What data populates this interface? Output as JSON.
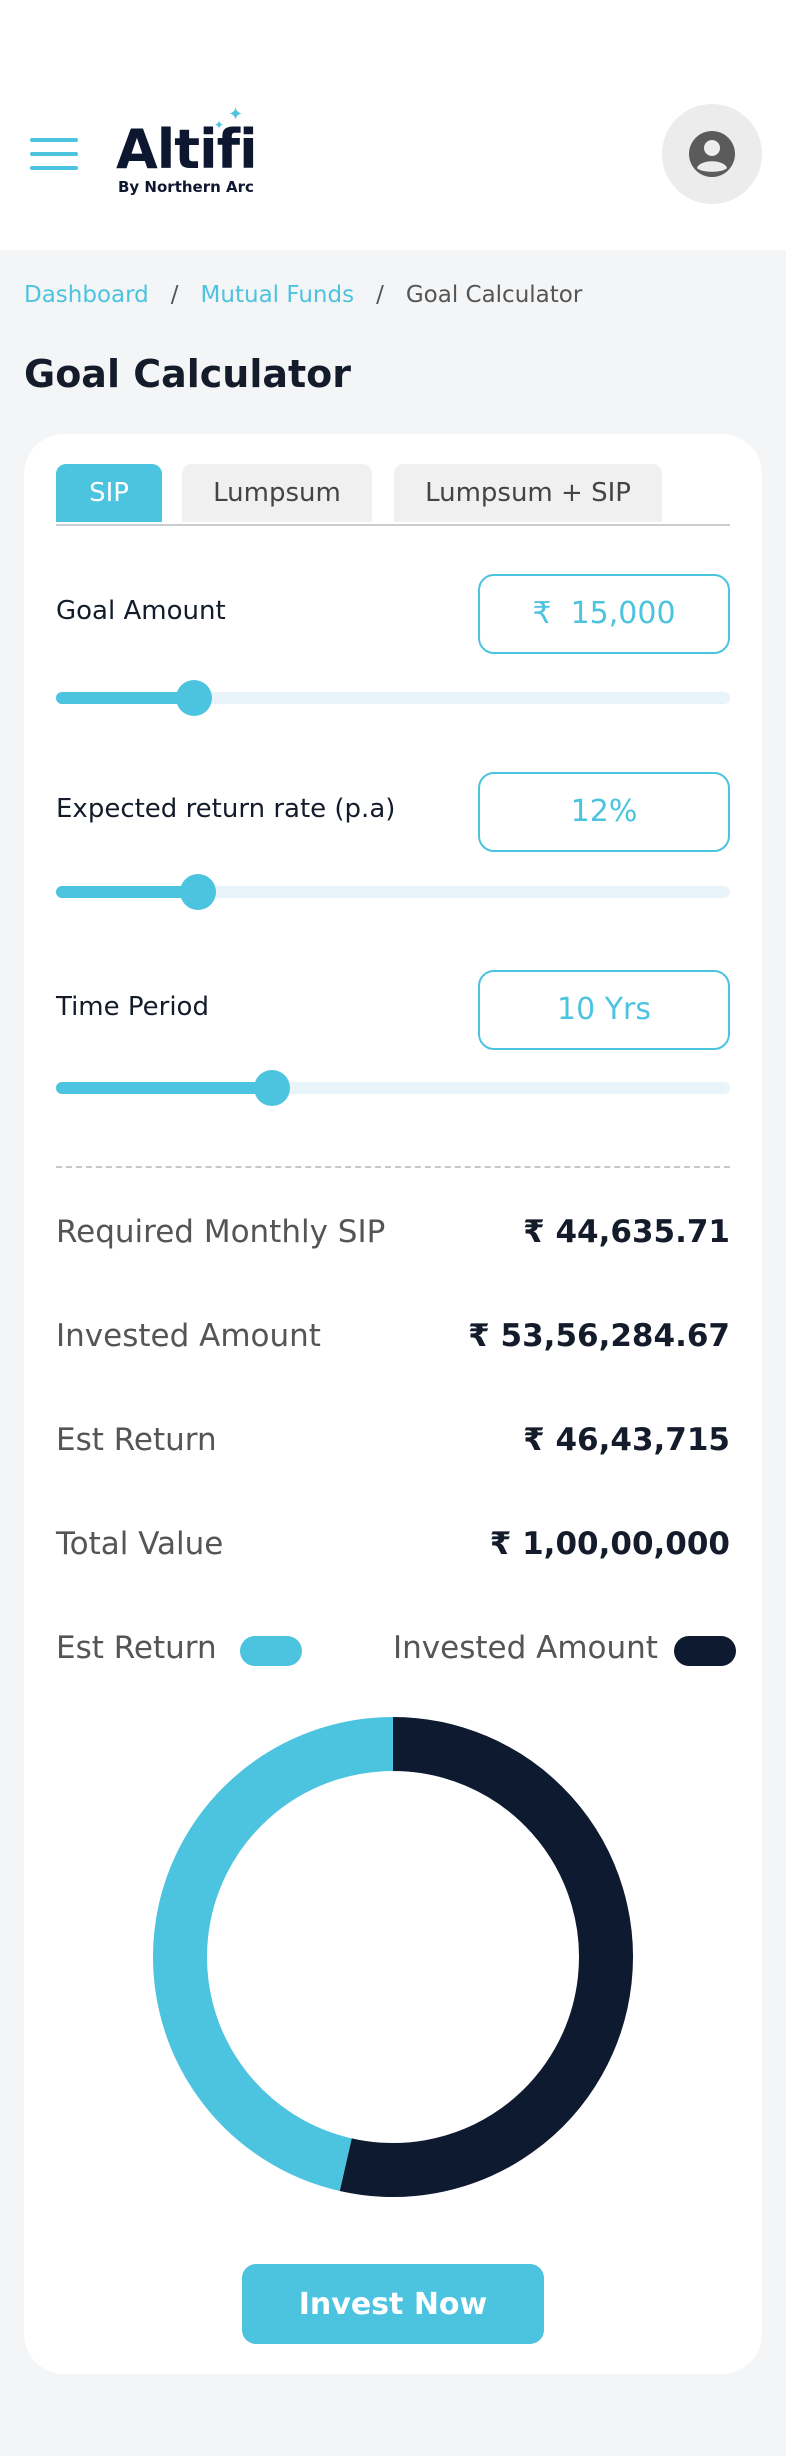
{
  "brand": {
    "logo_word": "Altifi",
    "logo_sub": "By Northern Arc",
    "accent": "#4cc3df",
    "dark": "#0e1a30"
  },
  "header": {
    "menu_icon": "hamburger-menu-icon",
    "avatar_icon": "user-avatar-icon"
  },
  "breadcrumb": {
    "items": [
      "Dashboard",
      "Mutual Funds",
      "Goal Calculator"
    ],
    "separator": "/"
  },
  "page_title": "Goal Calculator",
  "tabs": [
    {
      "label": "SIP",
      "active": true
    },
    {
      "label": "Lumpsum",
      "active": false
    },
    {
      "label": "Lumpsum + SIP",
      "active": false
    }
  ],
  "inputs": {
    "goal_amount": {
      "label": "Goal Amount",
      "value": "₹  15,000",
      "slider_percent": 20.5
    },
    "return_rate": {
      "label": "Expected return rate (p.a)",
      "value": "12%",
      "slider_percent": 21
    },
    "time_period": {
      "label": "Time Period",
      "value": "10 Yrs",
      "slider_percent": 32
    }
  },
  "results": [
    {
      "label": "Required Monthly SIP",
      "value": "₹ 44,635.71"
    },
    {
      "label": "Invested Amount",
      "value": "₹ 53,56,284.67"
    },
    {
      "label": "Est Return",
      "value": "₹ 46,43,715"
    },
    {
      "label": "Total Value",
      "value": "₹ 1,00,00,000"
    }
  ],
  "legend": {
    "est_return": {
      "label": "Est Return",
      "color": "#4cc3df"
    },
    "invested": {
      "label": "Invested Amount",
      "color": "#0e1a30"
    }
  },
  "chart_data": {
    "type": "pie",
    "categories": [
      "Invested Amount",
      "Est Return"
    ],
    "values": [
      5356284.67,
      4643715
    ],
    "colors": [
      "#0e1a30",
      "#4cc3df"
    ]
  },
  "cta": {
    "invest_now_label": "Invest Now"
  }
}
